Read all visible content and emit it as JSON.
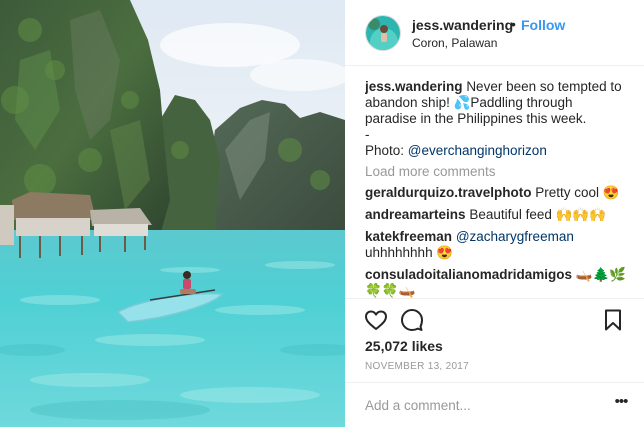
{
  "post": {
    "username": "jess.wandering",
    "separator": "•",
    "follow_label": "Follow",
    "location": "Coron, Palawan",
    "photo_description_icon": "lagoon-kayak-photo"
  },
  "caption": {
    "username": "jess.wandering",
    "line1": "Never been so tempted to",
    "line2": "abandon ship! 💦Paddling through",
    "line3": "paradise in the Philippines this week.",
    "line4": "-",
    "line5_prefix": "Photo: ",
    "line5_mention": "@everchanginghorizon"
  },
  "load_more_label": "Load more comments",
  "comments": [
    {
      "username": "geraldurquizo.travelphoto",
      "text": "Pretty cool 😍"
    },
    {
      "username": "andreamarteins",
      "text": "Beautiful feed 🙌🙌🙌"
    },
    {
      "username": "katekfreeman",
      "mention": "@zacharygfreeman",
      "text2": "uhhhhhhhh 😍"
    },
    {
      "username": "consuladoitalianomadridamigos",
      "text": "🛶🌲🌿",
      "text2": "🍀🍀🛶"
    }
  ],
  "actions": {
    "like_icon": "heart-icon",
    "comment_icon": "comment-icon",
    "save_icon": "bookmark-icon"
  },
  "likes": "25,072 likes",
  "date": "NOVEMBER 13, 2017",
  "add_comment": {
    "placeholder": "Add a comment...",
    "more_label": "•••"
  },
  "colors": {
    "link_blue": "#3897f0",
    "mention_blue": "#003569",
    "muted_gray": "#999999",
    "text": "#262626",
    "divider": "#efefef"
  }
}
